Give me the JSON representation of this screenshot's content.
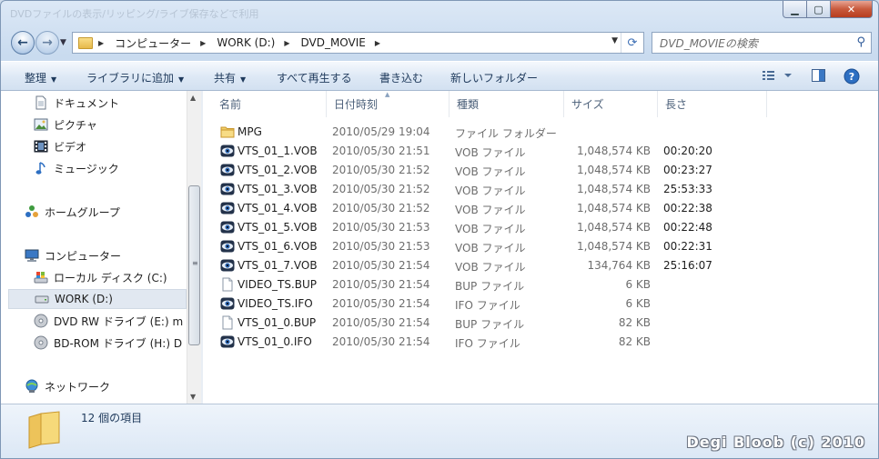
{
  "window": {
    "ghost_title": "DVDファイルの表示/リッピング/ライブ保存などで利用"
  },
  "address": {
    "crumbs": [
      "コンピューター",
      "WORK (D:)",
      "DVD_MOVIE"
    ]
  },
  "search": {
    "placeholder": "DVD_MOVIEの検索"
  },
  "toolbar": {
    "organize": "整理",
    "add_to_library": "ライブラリに追加",
    "share": "共有",
    "play_all": "すべて再生する",
    "burn": "書き込む",
    "new_folder": "新しいフォルダー"
  },
  "nav": {
    "items": [
      {
        "label": "ドキュメント",
        "icon": "documents-icon"
      },
      {
        "label": "ピクチャ",
        "icon": "pictures-icon"
      },
      {
        "label": "ビデオ",
        "icon": "videos-icon"
      },
      {
        "label": "ミュージック",
        "icon": "music-icon"
      },
      {
        "label": "ホームグループ",
        "icon": "homegroup-icon"
      },
      {
        "label": "コンピューター",
        "icon": "computer-icon"
      },
      {
        "label": "ローカル ディスク (C:)",
        "icon": "local-disk-icon"
      },
      {
        "label": "WORK (D:)",
        "icon": "drive-icon"
      },
      {
        "label": "DVD RW ドライブ (E:) m",
        "icon": "dvd-drive-icon"
      },
      {
        "label": "BD-ROM ドライブ (H:) D",
        "icon": "bd-drive-icon"
      },
      {
        "label": "ネットワーク",
        "icon": "network-icon"
      }
    ],
    "selected_index": 7
  },
  "columns": [
    "名前",
    "日付時刻",
    "種類",
    "サイズ",
    "長さ"
  ],
  "files": [
    {
      "name": "MPG",
      "date": "2010/05/29 19:04",
      "type": "ファイル フォルダー",
      "size": "",
      "length": "",
      "icon": "folder-icon"
    },
    {
      "name": "VTS_01_1.VOB",
      "date": "2010/05/30 21:51",
      "type": "VOB ファイル",
      "size": "1,048,574 KB",
      "length": "00:20:20",
      "icon": "media-file-icon"
    },
    {
      "name": "VTS_01_2.VOB",
      "date": "2010/05/30 21:52",
      "type": "VOB ファイル",
      "size": "1,048,574 KB",
      "length": "00:23:27",
      "icon": "media-file-icon"
    },
    {
      "name": "VTS_01_3.VOB",
      "date": "2010/05/30 21:52",
      "type": "VOB ファイル",
      "size": "1,048,574 KB",
      "length": "25:53:33",
      "icon": "media-file-icon"
    },
    {
      "name": "VTS_01_4.VOB",
      "date": "2010/05/30 21:52",
      "type": "VOB ファイル",
      "size": "1,048,574 KB",
      "length": "00:22:38",
      "icon": "media-file-icon"
    },
    {
      "name": "VTS_01_5.VOB",
      "date": "2010/05/30 21:53",
      "type": "VOB ファイル",
      "size": "1,048,574 KB",
      "length": "00:22:48",
      "icon": "media-file-icon"
    },
    {
      "name": "VTS_01_6.VOB",
      "date": "2010/05/30 21:53",
      "type": "VOB ファイル",
      "size": "1,048,574 KB",
      "length": "00:22:31",
      "icon": "media-file-icon"
    },
    {
      "name": "VTS_01_7.VOB",
      "date": "2010/05/30 21:54",
      "type": "VOB ファイル",
      "size": "134,764 KB",
      "length": "25:16:07",
      "icon": "media-file-icon"
    },
    {
      "name": "VIDEO_TS.BUP",
      "date": "2010/05/30 21:54",
      "type": "BUP ファイル",
      "size": "6 KB",
      "length": "",
      "icon": "blank-file-icon"
    },
    {
      "name": "VIDEO_TS.IFO",
      "date": "2010/05/30 21:54",
      "type": "IFO ファイル",
      "size": "6 KB",
      "length": "",
      "icon": "media-file-icon"
    },
    {
      "name": "VTS_01_0.BUP",
      "date": "2010/05/30 21:54",
      "type": "BUP ファイル",
      "size": "82 KB",
      "length": "",
      "icon": "blank-file-icon"
    },
    {
      "name": "VTS_01_0.IFO",
      "date": "2010/05/30 21:54",
      "type": "IFO ファイル",
      "size": "82 KB",
      "length": "",
      "icon": "media-file-icon"
    }
  ],
  "status": {
    "count_text": "12 個の項目"
  },
  "watermark": "Degi Bloob (c) 2010",
  "colors": {
    "accent": "#1e395b",
    "selection": "#e1e8f1",
    "secondary_text": "#6d6d6d"
  }
}
